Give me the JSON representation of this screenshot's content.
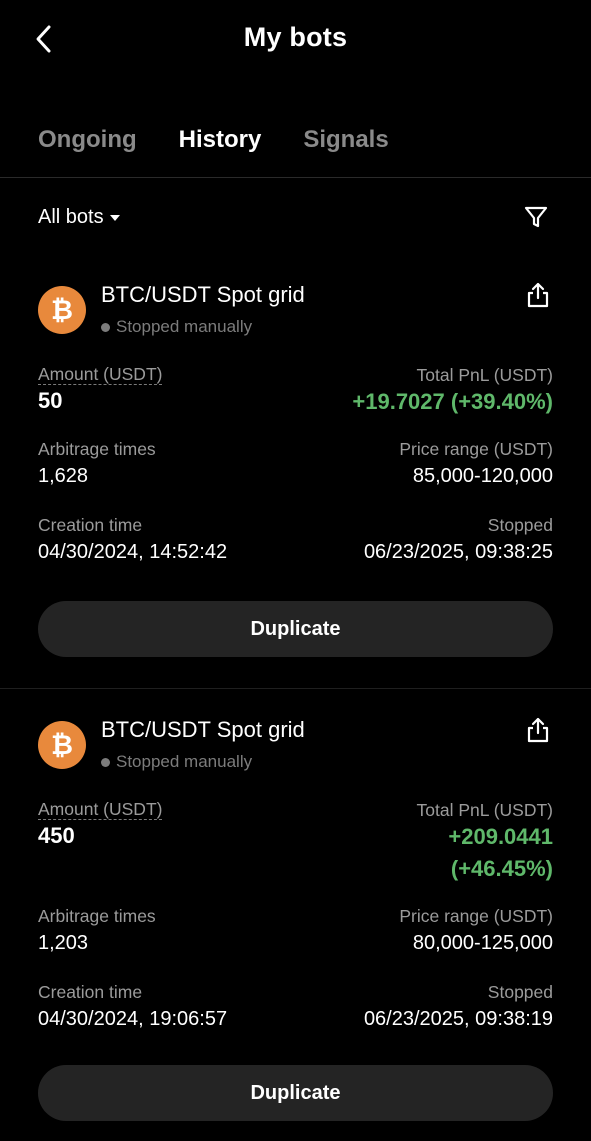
{
  "header": {
    "title": "My bots",
    "back_icon": "chevron-left-icon"
  },
  "tabs": [
    {
      "label": "Ongoing",
      "active": false
    },
    {
      "label": "History",
      "active": true
    },
    {
      "label": "Signals",
      "active": false
    }
  ],
  "filter": {
    "label": "All bots",
    "filter_icon": "funnel-icon"
  },
  "bots": [
    {
      "coin_symbol": "₿",
      "pair": "BTC/USDT Spot grid",
      "status": "Stopped manually",
      "amount_label": "Amount (USDT)",
      "amount": "50",
      "pnl_label": "Total PnL (USDT)",
      "pnl": "+19.7027 (+39.40%)",
      "arb_label": "Arbitrage times",
      "arb": "1,628",
      "range_label": "Price range (USDT)",
      "range": "85,000-120,000",
      "created_label": "Creation time",
      "created": "04/30/2024, 14:52:42",
      "stopped_label": "Stopped",
      "stopped": "06/23/2025, 09:38:25",
      "button": "Duplicate"
    },
    {
      "coin_symbol": "₿",
      "pair": "BTC/USDT Spot grid",
      "status": "Stopped manually",
      "amount_label": "Amount (USDT)",
      "amount": "450",
      "pnl_label": "Total PnL (USDT)",
      "pnl_line1": "+209.0441",
      "pnl_line2": "(+46.45%)",
      "arb_label": "Arbitrage times",
      "arb": "1,203",
      "range_label": "Price range (USDT)",
      "range": "80,000-125,000",
      "created_label": "Creation time",
      "created": "04/30/2024, 19:06:57",
      "stopped_label": "Stopped",
      "stopped": "06/23/2025, 09:38:19",
      "button": "Duplicate"
    }
  ],
  "colors": {
    "background": "#000000",
    "positive": "#5fb86a",
    "btc": "#e8893c",
    "button_bg": "#242424",
    "muted": "#9b9b9b"
  }
}
